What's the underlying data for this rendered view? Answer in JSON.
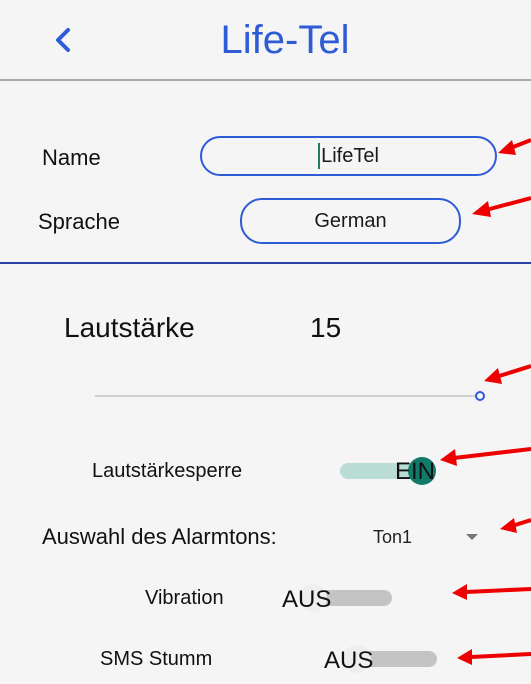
{
  "header": {
    "title": "Life-Tel"
  },
  "form": {
    "name_label": "Name",
    "name_value": "LifeTel",
    "language_label": "Sprache",
    "language_value": "German"
  },
  "volume": {
    "label": "Lautstärke",
    "value": "15",
    "slider_fraction": 1.0
  },
  "settings": {
    "volume_lock_label": "Lautstärkesperre",
    "volume_lock_state": "EIN",
    "alarm_tone_label": "Auswahl des Alarmtons:",
    "alarm_tone_value": "Ton1",
    "vibration_label": "Vibration",
    "vibration_state": "AUS",
    "sms_mute_label": "SMS Stumm",
    "sms_mute_state": "AUS"
  },
  "colors": {
    "accent": "#2e5bd6",
    "divider": "#2a3fa6",
    "toggle_on_thumb": "#127a68",
    "toggle_on_track": "#b9dcd5",
    "toggle_off_track": "#c4c4c4",
    "toggle_off_thumb": "#eeeeee",
    "annotation_arrow": "#ee0000"
  }
}
